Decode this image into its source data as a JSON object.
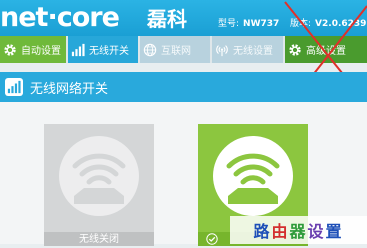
{
  "header": {
    "logo_text": "net·core",
    "logo_cn": "磊科",
    "model_label": "型号:",
    "model_value": "NW737",
    "version_label": "版本:",
    "version_value": "V2.0.6239"
  },
  "nav": {
    "items": [
      {
        "label": "自动设置",
        "icon": "gear-icon",
        "color": "#6fb93a"
      },
      {
        "label": "无线开关",
        "icon": "signal-bars-icon",
        "color": "#27a7d9"
      },
      {
        "label": "互联网",
        "icon": "globe-icon",
        "color": "#b8d2de"
      },
      {
        "label": "无线设置",
        "icon": "wifi-antenna-icon",
        "color": "#b8d2de"
      },
      {
        "label": "高级设置",
        "icon": "gear-icon",
        "color": "#4a9b2e"
      }
    ]
  },
  "section": {
    "title": "无线网络开关",
    "icon": "signal-bars-icon"
  },
  "cards": {
    "off_label": "无线关闭",
    "on_icon": "check-icon"
  },
  "watermark": {
    "c1": "路",
    "c2": "由",
    "c3": "器",
    "c4": "设",
    "c5": "置"
  },
  "colors": {
    "header_blue": "#1a9fd4",
    "active_green": "#8cc63f",
    "annotation_red": "#e0302a"
  }
}
